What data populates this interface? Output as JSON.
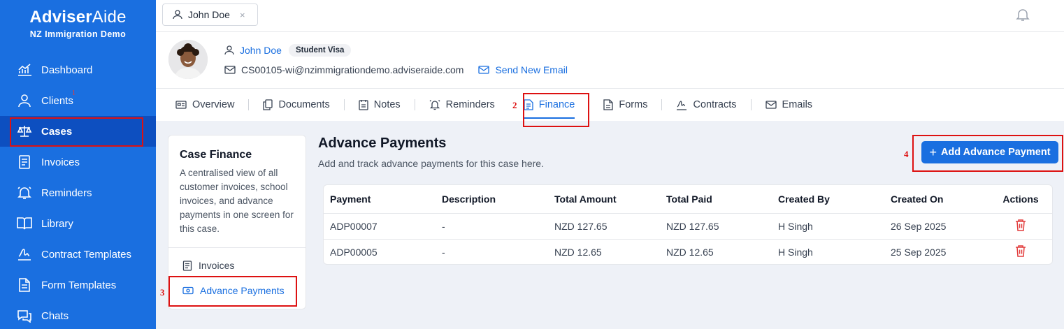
{
  "brand": {
    "name_bold": "Adviser",
    "name_light": "Aide",
    "subtitle": "NZ Immigration Demo"
  },
  "sidebar": {
    "items": [
      {
        "label": "Dashboard",
        "icon": "chart-icon"
      },
      {
        "label": "Clients",
        "icon": "user-icon"
      },
      {
        "label": "Cases",
        "icon": "scale-icon",
        "active": true
      },
      {
        "label": "Invoices",
        "icon": "invoice-icon"
      },
      {
        "label": "Reminders",
        "icon": "bell-icon"
      },
      {
        "label": "Library",
        "icon": "book-icon"
      },
      {
        "label": "Contract Templates",
        "icon": "signature-icon"
      },
      {
        "label": "Form Templates",
        "icon": "form-icon"
      },
      {
        "label": "Chats",
        "icon": "chat-icon"
      }
    ],
    "clients_badge": "1"
  },
  "topbar": {
    "client_tab": "John Doe",
    "close": "×"
  },
  "client": {
    "name": "John Doe",
    "visa": "Student Visa",
    "email": "CS00105-wi@nzimmigrationdemo.adviseraide.com",
    "send_email": "Send New Email"
  },
  "tabs": [
    {
      "label": "Overview",
      "icon": "id-card-icon"
    },
    {
      "label": "Documents",
      "icon": "documents-icon"
    },
    {
      "label": "Notes",
      "icon": "notes-icon"
    },
    {
      "label": "Reminders",
      "icon": "bell-icon"
    },
    {
      "label": "Finance",
      "icon": "finance-icon",
      "active": true
    },
    {
      "label": "Forms",
      "icon": "form-icon"
    },
    {
      "label": "Contracts",
      "icon": "signature-icon"
    },
    {
      "label": "Emails",
      "icon": "mail-icon"
    }
  ],
  "finance": {
    "card_title": "Case Finance",
    "card_desc": "A centralised view of all customer invoices, school invoices, and advance payments in one screen for this case.",
    "links": [
      {
        "label": "Invoices",
        "icon": "invoice-icon"
      },
      {
        "label": "Advance Payments",
        "icon": "cash-icon",
        "active": true
      }
    ],
    "title": "Advance Payments",
    "description": "Add and track advance payments for this case here.",
    "add_button": "Add Advance Payment",
    "add_plus": "+",
    "table": {
      "headers": [
        "Payment",
        "Description",
        "Total Amount",
        "Total Paid",
        "Created By",
        "Created On",
        "Actions"
      ],
      "rows": [
        [
          "ADP00007",
          "-",
          "NZD 127.65",
          "NZD 127.65",
          "H Singh",
          "26 Sep 2025"
        ],
        [
          "ADP00005",
          "-",
          "NZD 12.65",
          "NZD 12.65",
          "H Singh",
          "25 Sep 2025"
        ]
      ]
    }
  },
  "annotations": [
    "1",
    "2",
    "3",
    "4"
  ],
  "colors": {
    "primary": "#1a6fe0",
    "sidebar_active": "#0d4fc0",
    "danger": "#e23b3b",
    "annotation": "#dd1111"
  }
}
